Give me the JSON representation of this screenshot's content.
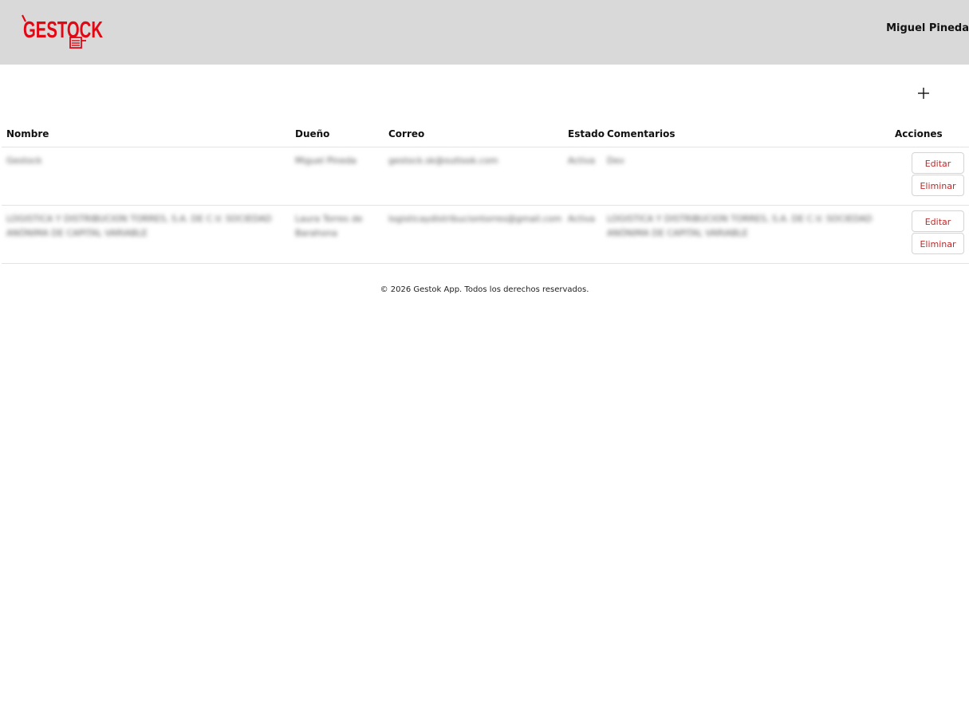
{
  "header": {
    "logo_text": "GESTOCK",
    "user_name": "Miguel Pineda",
    "brand_color": "#e30613",
    "background": "#d9d9d9"
  },
  "toolbar": {
    "add_icon": "plus-icon"
  },
  "table": {
    "columns": [
      "Nombre",
      "Dueño",
      "Correo",
      "Estado",
      "Comentarios",
      "Acciones"
    ],
    "rows": [
      {
        "nombre": "Gestock",
        "dueno": "Miguel Pineda",
        "correo": "gestock.sk@outlook.com",
        "estado": "Activa",
        "comentarios": "Dev",
        "edit_label": "Editar",
        "delete_label": "Eliminar"
      },
      {
        "nombre": "LOGISTICA Y DISTRIBUCION TORRES, S.A. DE C.V. SOCIEDAD ANÓNIMA DE CAPITAL VARIABLE",
        "dueno": "Laura Torres de Barahona",
        "correo": "logisticaydistribuciontorres@gmail.com",
        "estado": "Activa",
        "comentarios": "LOGISTICA Y DISTRIBUCION TORRES, S.A. DE C.V. SOCIEDAD ANÓNIMA DE CAPITAL VARIABLE",
        "edit_label": "Editar",
        "delete_label": "Eliminar"
      }
    ]
  },
  "footer": {
    "text": "© 2026 Gestok App. Todos los derechos reservados."
  }
}
